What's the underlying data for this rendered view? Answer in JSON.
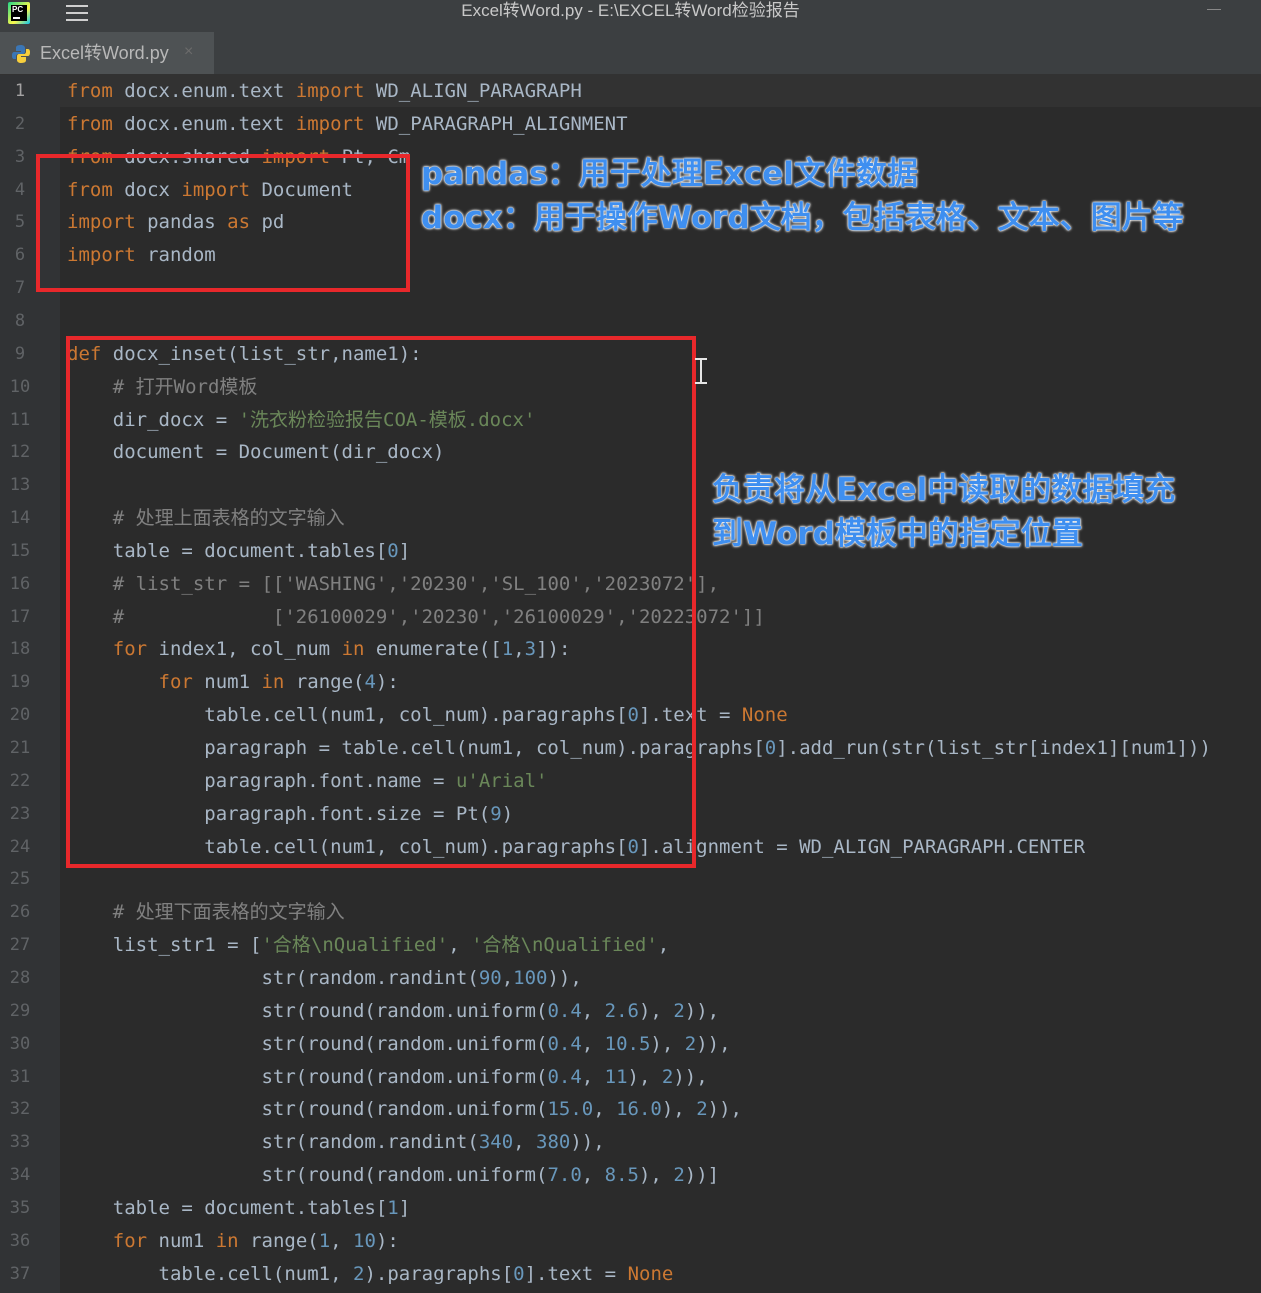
{
  "window": {
    "title": "Excel转Word.py - E:\\EXCEL转Word检验报告"
  },
  "tab": {
    "label": "Excel转Word.py",
    "close": "×",
    "icon": "python-file-icon"
  },
  "editor": {
    "current_line": 1,
    "lines": [
      {
        "n": "1",
        "tokens": [
          {
            "t": "from",
            "c": "kw"
          },
          {
            "t": " docx.enum.text "
          },
          {
            "t": "import",
            "c": "kw"
          },
          {
            "t": " WD_ALIGN_PARAGRAPH"
          }
        ]
      },
      {
        "n": "2",
        "tokens": [
          {
            "t": "from",
            "c": "kw"
          },
          {
            "t": " docx.enum.text "
          },
          {
            "t": "import",
            "c": "kw"
          },
          {
            "t": " WD_PARAGRAPH_ALIGNMENT"
          }
        ]
      },
      {
        "n": "3",
        "tokens": [
          {
            "t": "from",
            "c": "kw"
          },
          {
            "t": " docx.shared "
          },
          {
            "t": "import",
            "c": "kw"
          },
          {
            "t": " Pt, Cm"
          }
        ]
      },
      {
        "n": "4",
        "tokens": [
          {
            "t": "from",
            "c": "kw"
          },
          {
            "t": " docx "
          },
          {
            "t": "import",
            "c": "kw"
          },
          {
            "t": " Document"
          }
        ]
      },
      {
        "n": "5",
        "tokens": [
          {
            "t": "import",
            "c": "kw"
          },
          {
            "t": " pandas "
          },
          {
            "t": "as",
            "c": "kw"
          },
          {
            "t": " pd"
          }
        ]
      },
      {
        "n": "6",
        "tokens": [
          {
            "t": "import",
            "c": "kw"
          },
          {
            "t": " random"
          }
        ]
      },
      {
        "n": "7",
        "tokens": []
      },
      {
        "n": "8",
        "tokens": []
      },
      {
        "n": "9",
        "tokens": [
          {
            "t": "def",
            "c": "kw"
          },
          {
            "t": " docx_inset(list_str,name1):"
          }
        ]
      },
      {
        "n": "10",
        "tokens": [
          {
            "t": "    "
          },
          {
            "t": "# 打开Word模板",
            "c": "cmt"
          }
        ]
      },
      {
        "n": "11",
        "tokens": [
          {
            "t": "    dir_docx = "
          },
          {
            "t": "'洗衣粉检验报告COA-模板.docx'",
            "c": "str"
          }
        ]
      },
      {
        "n": "12",
        "tokens": [
          {
            "t": "    document = Document(dir_docx)"
          }
        ]
      },
      {
        "n": "13",
        "tokens": []
      },
      {
        "n": "14",
        "tokens": [
          {
            "t": "    "
          },
          {
            "t": "# 处理上面表格的文字输入",
            "c": "cmt"
          }
        ]
      },
      {
        "n": "15",
        "tokens": [
          {
            "t": "    table = document.tables["
          },
          {
            "t": "0",
            "c": "num"
          },
          {
            "t": "]"
          }
        ]
      },
      {
        "n": "16",
        "tokens": [
          {
            "t": "    "
          },
          {
            "t": "# list_str = [['WASHING','20230','SL_100','2023072'],",
            "c": "cmt"
          }
        ]
      },
      {
        "n": "17",
        "tokens": [
          {
            "t": "    "
          },
          {
            "t": "#             ['26100029','20230','26100029','20223072']]",
            "c": "cmt"
          }
        ]
      },
      {
        "n": "18",
        "tokens": [
          {
            "t": "    "
          },
          {
            "t": "for",
            "c": "kw"
          },
          {
            "t": " index1, col_num "
          },
          {
            "t": "in",
            "c": "kw"
          },
          {
            "t": " enumerate(["
          },
          {
            "t": "1",
            "c": "num"
          },
          {
            "t": ","
          },
          {
            "t": "3",
            "c": "num"
          },
          {
            "t": "]):"
          }
        ]
      },
      {
        "n": "19",
        "tokens": [
          {
            "t": "        "
          },
          {
            "t": "for",
            "c": "kw"
          },
          {
            "t": " num1 "
          },
          {
            "t": "in",
            "c": "kw"
          },
          {
            "t": " range("
          },
          {
            "t": "4",
            "c": "num"
          },
          {
            "t": "):"
          }
        ]
      },
      {
        "n": "20",
        "tokens": [
          {
            "t": "            table.cell(num1, col_num).paragraphs["
          },
          {
            "t": "0",
            "c": "num"
          },
          {
            "t": "].text = "
          },
          {
            "t": "None",
            "c": "none"
          }
        ]
      },
      {
        "n": "21",
        "tokens": [
          {
            "t": "            paragraph = table.cell(num1, col_num).paragraphs["
          },
          {
            "t": "0",
            "c": "num"
          },
          {
            "t": "].add_run(str(list_str[index1][num1]))"
          }
        ]
      },
      {
        "n": "22",
        "tokens": [
          {
            "t": "            paragraph.font.name = "
          },
          {
            "t": "u'Arial'",
            "c": "str"
          }
        ]
      },
      {
        "n": "23",
        "tokens": [
          {
            "t": "            paragraph.font.size = Pt("
          },
          {
            "t": "9",
            "c": "num"
          },
          {
            "t": ")"
          }
        ]
      },
      {
        "n": "24",
        "tokens": [
          {
            "t": "            table.cell(num1, col_num).paragraphs["
          },
          {
            "t": "0",
            "c": "num"
          },
          {
            "t": "].alignment = WD_ALIGN_PARAGRAPH.CENTER"
          }
        ]
      },
      {
        "n": "25",
        "tokens": []
      },
      {
        "n": "26",
        "tokens": [
          {
            "t": "    "
          },
          {
            "t": "# 处理下面表格的文字输入",
            "c": "cmt"
          }
        ]
      },
      {
        "n": "27",
        "tokens": [
          {
            "t": "    list_str1 = ["
          },
          {
            "t": "'合格\\nQualified'",
            "c": "str"
          },
          {
            "t": ", "
          },
          {
            "t": "'合格\\nQualified'",
            "c": "str"
          },
          {
            "t": ","
          }
        ]
      },
      {
        "n": "28",
        "tokens": [
          {
            "t": "                 str(random.randint("
          },
          {
            "t": "90",
            "c": "num"
          },
          {
            "t": ","
          },
          {
            "t": "100",
            "c": "num"
          },
          {
            "t": ")),"
          }
        ]
      },
      {
        "n": "29",
        "tokens": [
          {
            "t": "                 str(round(random.uniform("
          },
          {
            "t": "0.4",
            "c": "num"
          },
          {
            "t": ", "
          },
          {
            "t": "2.6",
            "c": "num"
          },
          {
            "t": "), "
          },
          {
            "t": "2",
            "c": "num"
          },
          {
            "t": ")),"
          }
        ]
      },
      {
        "n": "30",
        "tokens": [
          {
            "t": "                 str(round(random.uniform("
          },
          {
            "t": "0.4",
            "c": "num"
          },
          {
            "t": ", "
          },
          {
            "t": "10.5",
            "c": "num"
          },
          {
            "t": "), "
          },
          {
            "t": "2",
            "c": "num"
          },
          {
            "t": ")),"
          }
        ]
      },
      {
        "n": "31",
        "tokens": [
          {
            "t": "                 str(round(random.uniform("
          },
          {
            "t": "0.4",
            "c": "num"
          },
          {
            "t": ", "
          },
          {
            "t": "11",
            "c": "num"
          },
          {
            "t": "), "
          },
          {
            "t": "2",
            "c": "num"
          },
          {
            "t": ")),"
          }
        ]
      },
      {
        "n": "32",
        "tokens": [
          {
            "t": "                 str(round(random.uniform("
          },
          {
            "t": "15.0",
            "c": "num"
          },
          {
            "t": ", "
          },
          {
            "t": "16.0",
            "c": "num"
          },
          {
            "t": "), "
          },
          {
            "t": "2",
            "c": "num"
          },
          {
            "t": ")),"
          }
        ]
      },
      {
        "n": "33",
        "tokens": [
          {
            "t": "                 str(random.randint("
          },
          {
            "t": "340",
            "c": "num"
          },
          {
            "t": ", "
          },
          {
            "t": "380",
            "c": "num"
          },
          {
            "t": ")),"
          }
        ]
      },
      {
        "n": "34",
        "tokens": [
          {
            "t": "                 str(round(random.uniform("
          },
          {
            "t": "7.0",
            "c": "num"
          },
          {
            "t": ", "
          },
          {
            "t": "8.5",
            "c": "num"
          },
          {
            "t": "), "
          },
          {
            "t": "2",
            "c": "num"
          },
          {
            "t": "))]"
          }
        ]
      },
      {
        "n": "35",
        "tokens": [
          {
            "t": "    table = document.tables["
          },
          {
            "t": "1",
            "c": "num"
          },
          {
            "t": "]"
          }
        ]
      },
      {
        "n": "36",
        "tokens": [
          {
            "t": "    "
          },
          {
            "t": "for",
            "c": "kw"
          },
          {
            "t": " num1 "
          },
          {
            "t": "in",
            "c": "kw"
          },
          {
            "t": " range("
          },
          {
            "t": "1",
            "c": "num"
          },
          {
            "t": ", "
          },
          {
            "t": "10",
            "c": "num"
          },
          {
            "t": "):"
          }
        ]
      },
      {
        "n": "37",
        "tokens": [
          {
            "t": "        table.cell(num1, "
          },
          {
            "t": "2",
            "c": "num"
          },
          {
            "t": ").paragraphs["
          },
          {
            "t": "0",
            "c": "num"
          },
          {
            "t": "].text = "
          },
          {
            "t": "None",
            "c": "none"
          }
        ]
      }
    ]
  },
  "annotations": {
    "imports_line1": "pandas：用于处理Excel文件数据",
    "imports_line2": "docx：用于操作Word文档，包括表格、文本、图片等",
    "function_line1": "负责将从Excel中读取的数据填充",
    "function_line2": "到Word模板中的指定位置"
  },
  "colors": {
    "editor_bg": "#2b2b2b",
    "gutter_bg": "#313335",
    "keyword": "#cc7832",
    "string": "#6a8759",
    "number": "#6897bb",
    "comment": "#808080",
    "highlight_box": "#e8282b",
    "annotation_text": "#3f8ff0"
  }
}
